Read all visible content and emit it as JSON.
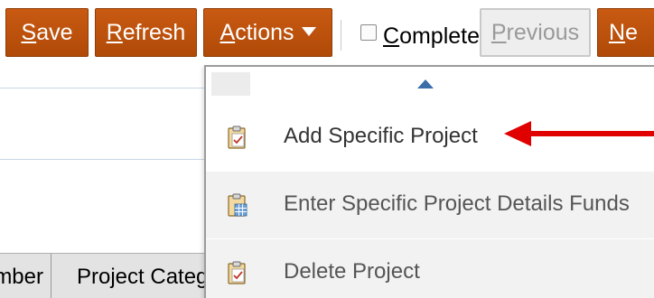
{
  "toolbar": {
    "save": {
      "lead": "S",
      "rest": "ave"
    },
    "refresh": {
      "lead": "R",
      "rest": "efresh"
    },
    "actions": {
      "lead": "A",
      "rest": "ctions"
    },
    "complete": {
      "lead": "C",
      "rest": "omplete"
    },
    "previous": {
      "lead": "P",
      "rest": "revious"
    },
    "next": {
      "lead": "N",
      "rest": "e"
    }
  },
  "table": {
    "columns": [
      "mber",
      "Project Catego"
    ]
  },
  "menu": {
    "items": [
      {
        "label": "Add Specific Project",
        "icon": "clipboard-check-icon"
      },
      {
        "label": "Enter Specific Project Details Funds",
        "icon": "clipboard-table-icon"
      },
      {
        "label": "Delete Project",
        "icon": "clipboard-check-icon"
      }
    ]
  },
  "colors": {
    "button_orange": "#c95a12",
    "annotation_red": "#e00000",
    "caret_blue": "#3b6ea8"
  }
}
